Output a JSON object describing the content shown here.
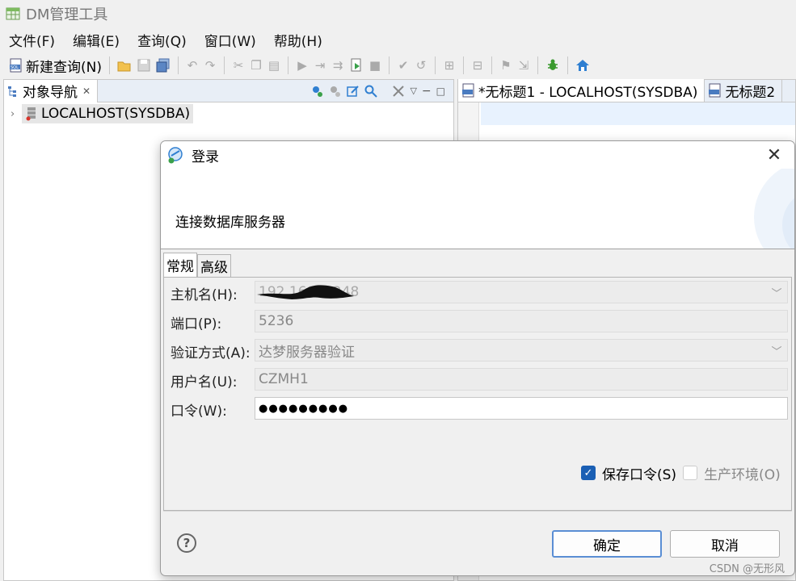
{
  "window": {
    "title": "DM管理工具"
  },
  "menus": [
    "文件(F)",
    "编辑(E)",
    "查询(Q)",
    "窗口(W)",
    "帮助(H)"
  ],
  "toolbar": {
    "new_query_label": "新建查询(N)"
  },
  "navigator": {
    "tab_label": "对象导航",
    "tree": [
      {
        "label": "LOCALHOST(SYSDBA)",
        "expanded": false
      }
    ]
  },
  "editor": {
    "tabs": [
      {
        "label": "*无标题1 - LOCALHOST(SYSDBA)",
        "active": true
      },
      {
        "label": "无标题2",
        "active": false
      }
    ]
  },
  "dialog": {
    "title": "登录",
    "subtitle": "连接数据库服务器",
    "tabs": [
      {
        "label": "常规",
        "active": true
      },
      {
        "label": "高级",
        "active": false
      }
    ],
    "fields": {
      "host": {
        "label": "主机名(H):",
        "value": "192.168.1.248"
      },
      "port": {
        "label": "端口(P):",
        "value": "5236"
      },
      "auth": {
        "label": "验证方式(A):",
        "value": "达梦服务器验证"
      },
      "user": {
        "label": "用户名(U):",
        "value": "CZMH1"
      },
      "password": {
        "label": "口令(W):",
        "value": "●●●●●●●●●"
      }
    },
    "save_password": {
      "label": "保存口令(S)",
      "checked": true
    },
    "production": {
      "label": "生产环境(O)",
      "checked": false,
      "enabled": false
    },
    "ok_label": "确定",
    "cancel_label": "取消"
  },
  "watermark": "CSDN @无形风",
  "colors": {
    "accent": "#1a5fb4",
    "default_button_border": "#5a8ed4"
  }
}
